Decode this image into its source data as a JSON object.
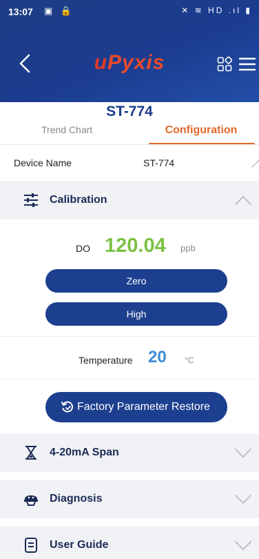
{
  "status_bar": {
    "time": "13:07",
    "left_icons": "▣ 🔒",
    "right_icons": "✕ ≋ HD .ıl ▮"
  },
  "header": {
    "logo_prefix": "u",
    "logo_rest": "Pyxis",
    "back_icon": "chevron-left-icon",
    "grid_icon": "grid-icon",
    "menu_icon": "menu-icon"
  },
  "device": {
    "title": "ST-774"
  },
  "tabs": {
    "trend": "Trend Chart",
    "config": "Configuration",
    "active": "Configuration"
  },
  "device_name": {
    "label": "Device Name",
    "value": "ST-774"
  },
  "calibration": {
    "title": "Calibration",
    "do_label": "DO",
    "do_value": "120.04",
    "do_unit": "ppb",
    "zero_label": "Zero",
    "high_label": "High",
    "temp_label": "Temperature",
    "temp_value": "20",
    "temp_unit": "°C",
    "restore_label": "Factory Parameter Restore",
    "expanded": true
  },
  "sections": {
    "span": "4-20mA Span",
    "diagnosis": "Diagnosis",
    "guide": "User Guide"
  },
  "colors": {
    "header_blue": "#1b3c8f",
    "accent_orange": "#e0692a",
    "do_green": "#7bc142",
    "temp_blue": "#3e8bd6",
    "button_blue": "#1d3f8f"
  }
}
